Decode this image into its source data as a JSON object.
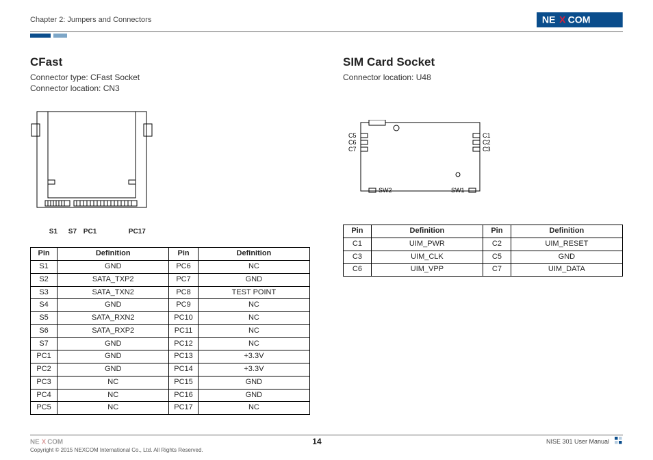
{
  "header": {
    "chapter": "Chapter 2: Jumpers and Connectors",
    "brand": "NEXCOM"
  },
  "left": {
    "title": "CFast",
    "line1": "Connector type: CFast Socket",
    "line2": "Connector location: CN3",
    "fig_labels": {
      "s1": "S1",
      "s7": "S7",
      "pc1": "PC1",
      "pc17": "PC17"
    },
    "table": {
      "headers": {
        "pin": "Pin",
        "def": "Definition"
      },
      "rows": [
        {
          "p1": "S1",
          "d1": "GND",
          "p2": "PC6",
          "d2": "NC"
        },
        {
          "p1": "S2",
          "d1": "SATA_TXP2",
          "p2": "PC7",
          "d2": "GND"
        },
        {
          "p1": "S3",
          "d1": "SATA_TXN2",
          "p2": "PC8",
          "d2": "TEST POINT"
        },
        {
          "p1": "S4",
          "d1": "GND",
          "p2": "PC9",
          "d2": "NC"
        },
        {
          "p1": "S5",
          "d1": "SATA_RXN2",
          "p2": "PC10",
          "d2": "NC"
        },
        {
          "p1": "S6",
          "d1": "SATA_RXP2",
          "p2": "PC11",
          "d2": "NC"
        },
        {
          "p1": "S7",
          "d1": "GND",
          "p2": "PC12",
          "d2": "NC"
        },
        {
          "p1": "PC1",
          "d1": "GND",
          "p2": "PC13",
          "d2": "+3.3V"
        },
        {
          "p1": "PC2",
          "d1": "GND",
          "p2": "PC14",
          "d2": "+3.3V"
        },
        {
          "p1": "PC3",
          "d1": "NC",
          "p2": "PC15",
          "d2": "GND"
        },
        {
          "p1": "PC4",
          "d1": "NC",
          "p2": "PC16",
          "d2": "GND"
        },
        {
          "p1": "PC5",
          "d1": "NC",
          "p2": "PC17",
          "d2": "NC"
        }
      ]
    }
  },
  "right": {
    "title": "SIM Card Socket",
    "line1": "Connector location: U48",
    "fig_labels": {
      "c1": "C1",
      "c2": "C2",
      "c3": "C3",
      "c5": "C5",
      "c6": "C6",
      "c7": "C7",
      "sw1": "SW1",
      "sw2": "SW2"
    },
    "table": {
      "headers": {
        "pin": "Pin",
        "def": "Definition"
      },
      "rows": [
        {
          "p1": "C1",
          "d1": "UIM_PWR",
          "p2": "C2",
          "d2": "UIM_RESET"
        },
        {
          "p1": "C3",
          "d1": "UIM_CLK",
          "p2": "C5",
          "d2": "GND"
        },
        {
          "p1": "C6",
          "d1": "UIM_VPP",
          "p2": "C7",
          "d2": "UIM_DATA"
        }
      ]
    }
  },
  "footer": {
    "copyright": "Copyright © 2015 NEXCOM International Co., Ltd. All Rights Reserved.",
    "page": "14",
    "manual": "NISE 301 User Manual"
  }
}
